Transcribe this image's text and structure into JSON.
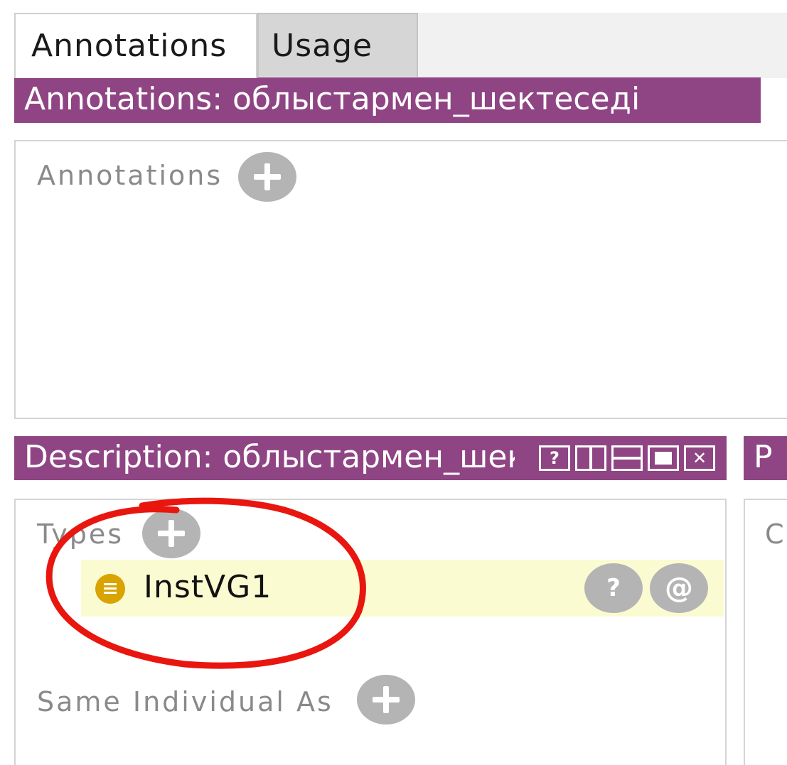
{
  "tabs": [
    {
      "label": "Annotations",
      "active": true
    },
    {
      "label": "Usage",
      "active": false
    }
  ],
  "annotations_header": {
    "title": "Annotations: облыстармен_шектеседі"
  },
  "annotations_panel": {
    "section_label": "Annotations"
  },
  "description_header": {
    "title": "Description: облыстармен_шектеседі"
  },
  "property_header": {
    "title": "P"
  },
  "property_panel": {
    "label": "C"
  },
  "description_panel": {
    "types_label": "Types",
    "type_items": [
      {
        "name": "InstVG1",
        "explain_label": "?",
        "annotate_label": "@"
      }
    ],
    "same_individual_label": "Same Individual As"
  },
  "colors": {
    "header_bg": "#8f4583",
    "type_row_bg": "#fbfbd2",
    "class_icon": "#d9a300",
    "highlight_circle": "#e8160f"
  },
  "icons": {
    "add": "plus-circle-icon",
    "class": "class-icon",
    "help": "help-icon",
    "close": "close-icon"
  }
}
